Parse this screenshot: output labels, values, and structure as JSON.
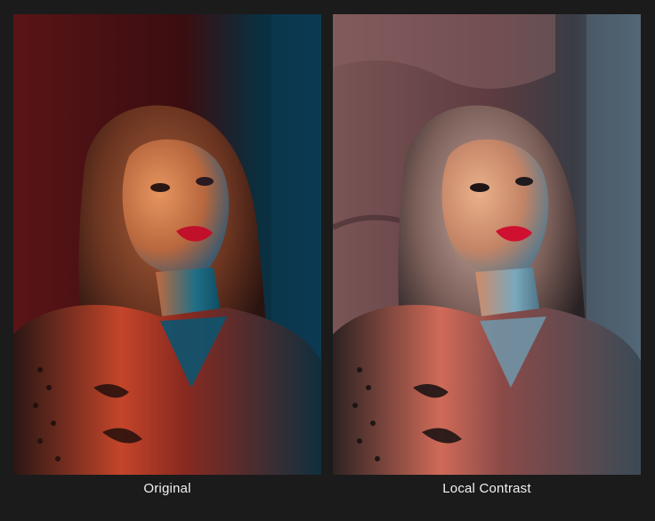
{
  "comparison": {
    "left": {
      "caption": "Original",
      "colors": {
        "wall": "#5a1416",
        "backlight": "#0b5a78",
        "hair": "#8a4a2a",
        "skin": "#d98855",
        "lips": "#c0102a"
      }
    },
    "right": {
      "caption": "Local Contrast",
      "colors": {
        "wall": "#6d4a4a",
        "backlight": "#6a8fa3",
        "hair": "#a48a80",
        "skin": "#e0a078",
        "lips": "#d01030"
      }
    }
  }
}
